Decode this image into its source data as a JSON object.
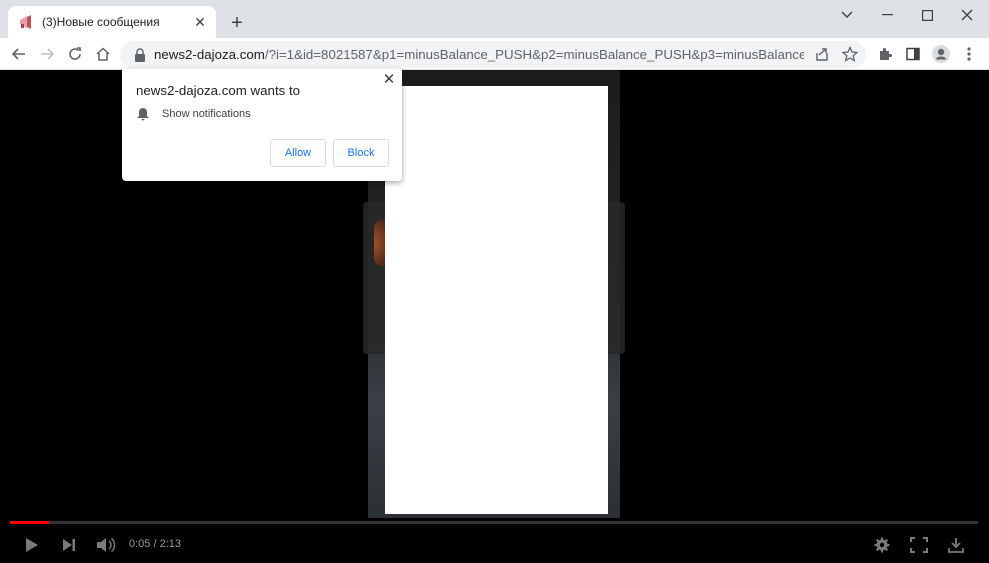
{
  "tab": {
    "title": "(3)Новые сообщения"
  },
  "omnibox": {
    "host": "news2-dajoza.com",
    "path": "/?i=1&id=8021587&p1=minusBalance_PUSH&p2=minusBalance_PUSH&p3=minusBalance_PUSH&..."
  },
  "permission_prompt": {
    "title": "news2-dajoza.com wants to",
    "permission": "Show notifications",
    "allow_label": "Allow",
    "block_label": "Block"
  },
  "video": {
    "time": "0:05 / 2:13",
    "progress": 0.04,
    "accent_color": "#ff0000"
  },
  "colors": {
    "tabstrip": "#dee1e6",
    "link_blue": "#1a73e8"
  }
}
